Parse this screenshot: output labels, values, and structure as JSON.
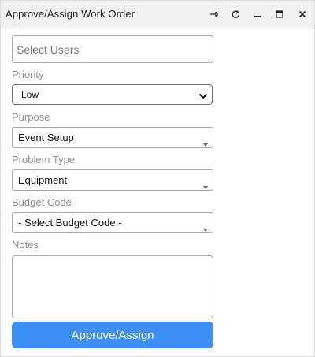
{
  "window": {
    "title": "Approve/Assign Work Order",
    "controls": [
      "pin-icon",
      "refresh-icon",
      "minimize-icon",
      "maximize-icon",
      "close-icon"
    ]
  },
  "form": {
    "users": {
      "placeholder": "Select Users"
    },
    "priority": {
      "label": "Priority",
      "value": "Low"
    },
    "purpose": {
      "label": "Purpose",
      "value": "Event Setup"
    },
    "problem_type": {
      "label": "Problem Type",
      "value": "Equipment"
    },
    "budget_code": {
      "label": "Budget Code",
      "value": "- Select Budget Code -"
    },
    "notes": {
      "label": "Notes",
      "value": ""
    },
    "submit_label": "Approve/Assign"
  },
  "colors": {
    "accent": "#3b8ff5"
  }
}
